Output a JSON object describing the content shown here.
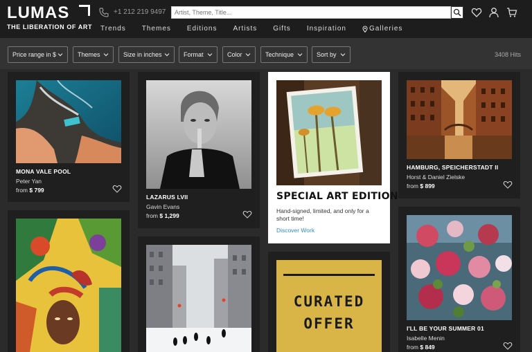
{
  "brand": {
    "name": "LUMAS",
    "tagline": "THE LIBERATION OF ART"
  },
  "header": {
    "phone": "+1 212 219 9497",
    "search_placeholder": "Artist, Theme, Title...",
    "icons": [
      "phone-icon",
      "search-icon",
      "heart-icon",
      "user-icon",
      "cart-icon"
    ]
  },
  "nav": [
    "Trends",
    "Themes",
    "Editions",
    "Artists",
    "Gifts",
    "Inspiration",
    "Galleries"
  ],
  "filters": [
    "Price range in $",
    "Themes",
    "Size in inches",
    "Format",
    "Color",
    "Technique",
    "Sort by"
  ],
  "hits": "3408 Hits",
  "cards": [
    {
      "title": "MONA VALE POOL",
      "artist": "Peter Yan",
      "price_prefix": "from",
      "price": "$ 799"
    },
    {
      "title": "LAZARUS LVII",
      "artist": "Gavin Evans",
      "price_prefix": "from",
      "price": "$ 1,299"
    },
    {
      "title": "HAMBURG, SPEICHERSTADT II",
      "artist": "Horst & Daniel Zielske",
      "price_prefix": "from",
      "price": "$ 899"
    },
    {
      "title": "I'LL BE YOUR SUMMER 01",
      "artist": "Isabelle Menin",
      "price_prefix": "from",
      "price": "$ 849"
    }
  ],
  "special": {
    "title": "SPECIAL ART EDITION",
    "description": "Hand-signed, limited, and only for a short time!",
    "link": "Discover Work"
  },
  "curated": {
    "line1": "CURATED",
    "line2": "OFFER"
  },
  "colors": {
    "header_bg": "#1d1d1d",
    "page_bg": "#2b2b2b",
    "card_bg": "#1f1f1f",
    "link": "#2b8fc7",
    "curated_gold": "#d9b548"
  }
}
